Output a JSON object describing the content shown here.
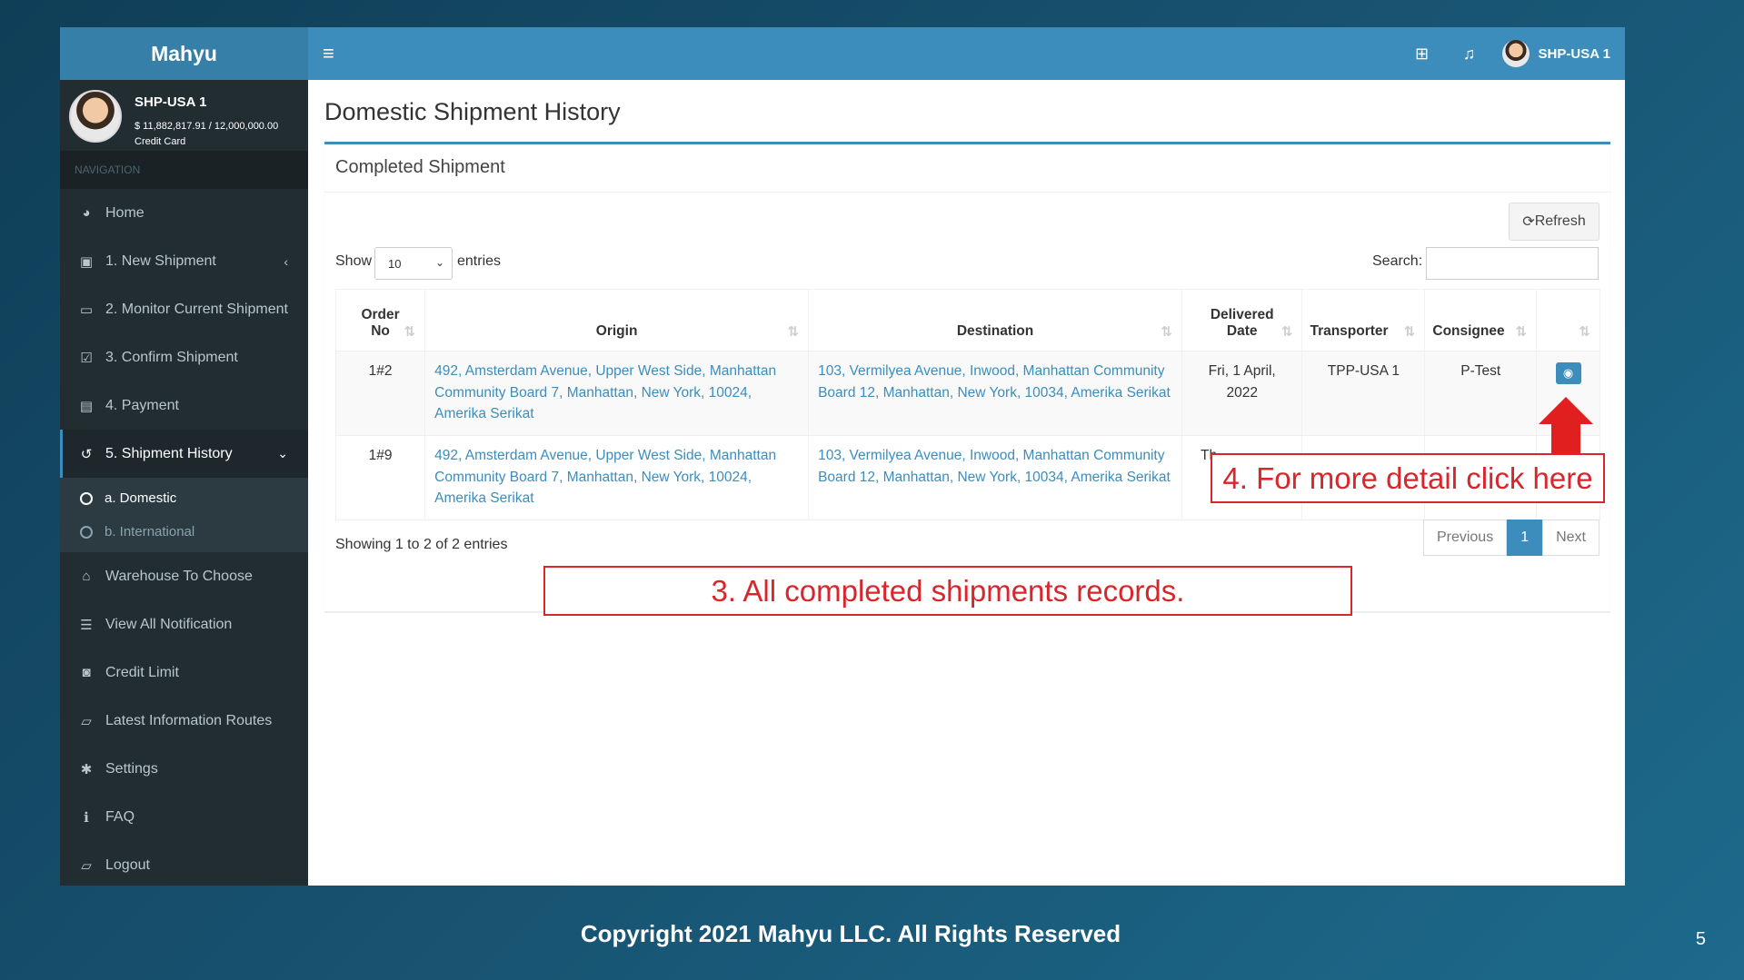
{
  "app": {
    "brand": "Mahyu"
  },
  "user": {
    "name": "SHP-USA 1",
    "credit": "$ 11,882,817.91 / 12,000,000.00",
    "card_label": "Credit Card"
  },
  "sidebar": {
    "nav_header": "NAVIGATION",
    "items": [
      {
        "label": "Home",
        "icon": "dashboard-icon"
      },
      {
        "label": "1. New Shipment",
        "icon": "archive-icon",
        "chevron": "‹"
      },
      {
        "label": "2. Monitor Current Shipment",
        "icon": "laptop-icon"
      },
      {
        "label": "3. Confirm Shipment",
        "icon": "check-square-icon"
      },
      {
        "label": "4. Payment",
        "icon": "credit-card-icon"
      },
      {
        "label": "5. Shipment History",
        "icon": "history-icon",
        "chevron": "⌄",
        "active": true
      },
      {
        "label": "Warehouse To Choose",
        "icon": "warehouse-icon"
      },
      {
        "label": "View All Notification",
        "icon": "list-icon"
      },
      {
        "label": "Credit Limit",
        "icon": "money-icon"
      },
      {
        "label": "Latest Information Routes",
        "icon": "book-icon"
      },
      {
        "label": "Settings",
        "icon": "gear-icon"
      },
      {
        "label": "FAQ",
        "icon": "info-icon"
      },
      {
        "label": "Logout",
        "icon": "book-icon"
      }
    ],
    "submenu": [
      {
        "label": "a. Domestic",
        "active": true
      },
      {
        "label": "b. International"
      }
    ]
  },
  "header": {
    "user_name": "SHP-USA 1"
  },
  "page": {
    "title": "Domestic Shipment History",
    "box_title": "Completed Shipment",
    "refresh_label": "Refresh",
    "show_label": "Show",
    "entries_label": "entries",
    "length_value": "10",
    "search_label": "Search:",
    "search_value": ""
  },
  "table": {
    "columns": [
      "Order No",
      "Origin",
      "Destination",
      "Delivered Date",
      "Transporter",
      "Consignee",
      ""
    ],
    "column_lines": {
      "order": [
        "Order",
        "No"
      ],
      "delivered": [
        "Delivered",
        "Date"
      ]
    },
    "rows": [
      {
        "order_no": "1#2",
        "origin": "492, Amsterdam Avenue, Upper West Side, Manhattan Community Board 7, Manhattan, New York, 10024, Amerika Serikat",
        "destination": "103, Vermilyea Avenue, Inwood, Manhattan Community Board 12, Manhattan, New York, 10034, Amerika Serikat",
        "delivered_date": "Fri, 1 April, 2022",
        "transporter": "TPP-USA 1",
        "consignee": "P-Test"
      },
      {
        "order_no": "1#9",
        "origin": "492, Amsterdam Avenue, Upper West Side, Manhattan Community Board 7, Manhattan, New York, 10024, Amerika Serikat",
        "destination": "103, Vermilyea Avenue, Inwood, Manhattan Community Board 12, Manhattan, New York, 10034, Amerika Serikat",
        "delivered_date": "Th",
        "transporter": "",
        "consignee": ""
      }
    ]
  },
  "footer": {
    "info": "Showing 1 to 2 of 2 entries",
    "prev": "Previous",
    "page": "1",
    "next": "Next"
  },
  "annotations": {
    "detail": "4. For more detail click here",
    "records": "3. All completed shipments records."
  },
  "slide": {
    "copyright": "Copyright 2021 Mahyu LLC. All Rights Reserved",
    "page_number": "5"
  },
  "colors": {
    "accent": "#3c8dbc",
    "sidebar": "#222d32",
    "annotation": "#d7262c"
  }
}
